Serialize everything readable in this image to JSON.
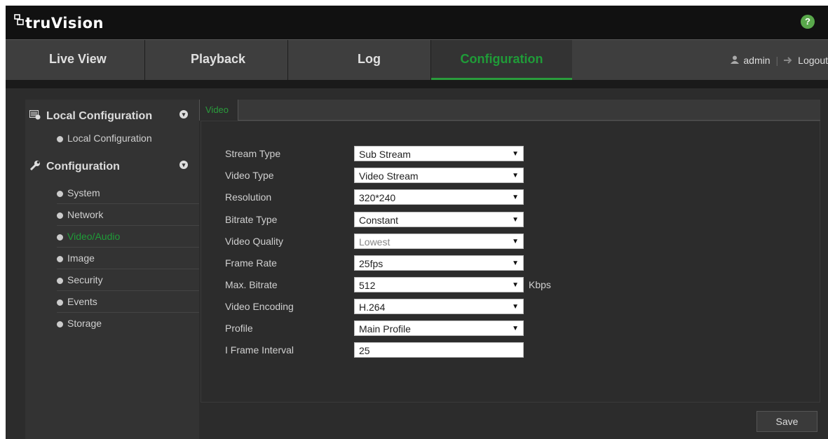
{
  "brand": {
    "name": "truVision"
  },
  "help": {
    "label": "?"
  },
  "nav": {
    "tabs": [
      "Live View",
      "Playback",
      "Log",
      "Configuration"
    ],
    "user": "admin",
    "logout": "Logout"
  },
  "sidebar": {
    "groups": [
      {
        "label": "Local Configuration",
        "items": [
          "Local Configuration"
        ]
      },
      {
        "label": "Configuration",
        "items": [
          "System",
          "Network",
          "Video/Audio",
          "Image",
          "Security",
          "Events",
          "Storage"
        ]
      }
    ]
  },
  "content": {
    "tab": "Video",
    "fields": [
      {
        "label": "Stream Type",
        "value": "Sub Stream"
      },
      {
        "label": "Video Type",
        "value": "Video Stream"
      },
      {
        "label": "Resolution",
        "value": "320*240"
      },
      {
        "label": "Bitrate Type",
        "value": "Constant"
      },
      {
        "label": "Video Quality",
        "value": "Lowest"
      },
      {
        "label": "Frame Rate",
        "value": "25fps"
      },
      {
        "label": "Max. Bitrate",
        "value": "512",
        "unit": "Kbps"
      },
      {
        "label": "Video Encoding",
        "value": "H.264"
      },
      {
        "label": "Profile",
        "value": "Main Profile"
      },
      {
        "label": "I Frame Interval",
        "value": "25"
      }
    ],
    "save_label": "Save"
  },
  "colors": {
    "accent": "#2a9c3c",
    "help_bg": "#59a84b"
  }
}
